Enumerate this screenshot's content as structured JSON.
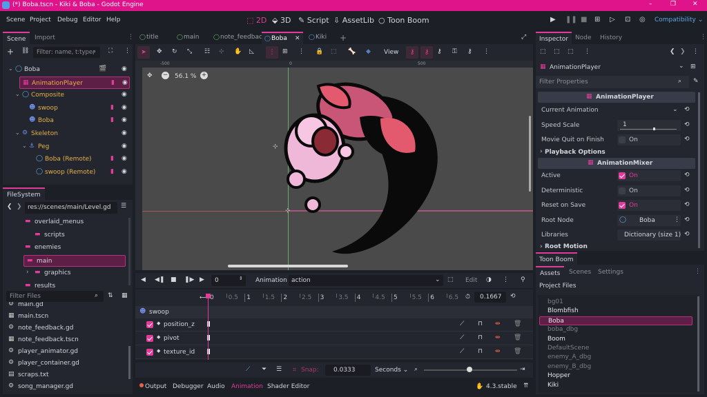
{
  "titlebar": {
    "title": "(*) Boba.tscn - Kiki & Boba - Godot Engine",
    "minimize": "–",
    "maximize": "❐",
    "close": "✕"
  },
  "menu": [
    "Scene",
    "Project",
    "Debug",
    "Editor",
    "Help"
  ],
  "main_tabs": [
    "2D",
    "3D",
    "Script",
    "AssetLib",
    "Toon Boom"
  ],
  "renderer": "Compatibility",
  "scene_dock": {
    "tabs": [
      "Scene",
      "Import"
    ],
    "filter_placeholder": "Filter: name, t:type,",
    "tree": [
      {
        "label": "Boba",
        "indent": 0,
        "color": "#d4d6dc"
      },
      {
        "label": "AnimationPlayer",
        "indent": 1,
        "color": "#e7b24a",
        "selected": true
      },
      {
        "label": "Composite",
        "indent": 1,
        "color": "#e7b24a"
      },
      {
        "label": "swoop",
        "indent": 2,
        "color": "#e7b24a"
      },
      {
        "label": "Boba",
        "indent": 2,
        "color": "#e7b24a"
      },
      {
        "label": "Skeleton",
        "indent": 1,
        "color": "#e7b24a"
      },
      {
        "label": "Peg",
        "indent": 2,
        "color": "#e7b24a"
      },
      {
        "label": "Boba (Remote)",
        "indent": 3,
        "color": "#e7b24a"
      },
      {
        "label": "swoop (Remote)",
        "indent": 3,
        "color": "#e7b24a"
      }
    ]
  },
  "filesystem": {
    "tab": "FileSystem",
    "path": "res://scenes/main/Level.gd",
    "folders": [
      "overlaid_menus",
      "scripts",
      "enemies",
      "main",
      "graphics",
      "results"
    ],
    "filter_placeholder": "Filter Files",
    "files": [
      "main.gd",
      "main.tscn",
      "note_feedback.gd",
      "note_feedback.tscn",
      "player_animator.gd",
      "player_container.gd",
      "scraps.txt",
      "song_manager.gd"
    ]
  },
  "editor_tabs": [
    "title",
    "main",
    "note_feedback",
    "Boba",
    "Kiki"
  ],
  "toolbar": {
    "view": "View"
  },
  "viewport": {
    "zoom": "56.1 %",
    "ruler": [
      "-500",
      "0",
      "500"
    ],
    "vruler": [
      "-500",
      "0"
    ]
  },
  "animation": {
    "frame": "0",
    "label": "Animation",
    "name": "action",
    "edit": "Edit",
    "ticks": [
      "0",
      "0.5",
      "1",
      "1.5",
      "2",
      "2.5",
      "3",
      "3.5",
      "4",
      "4.5",
      "5",
      "5.5",
      "6",
      "6.5"
    ],
    "length": "0.1667",
    "track_group": "swoop",
    "tracks": [
      "position_z",
      "pivot",
      "texture_id"
    ],
    "snap_label": "Snap:",
    "snap_value": "0.0333",
    "unit": "Seconds"
  },
  "bottom_tabs": [
    "Output",
    "Debugger",
    "Audio",
    "Animation",
    "Shader Editor"
  ],
  "version": "4.3.stable",
  "inspector": {
    "tabs": [
      "Inspector",
      "Node",
      "History"
    ],
    "object": "AnimationPlayer",
    "filter_placeholder": "Filter Properties",
    "section1": "AnimationPlayer",
    "props1": [
      {
        "name": "Current Animation",
        "value": ""
      },
      {
        "name": "Speed Scale",
        "value": "1"
      },
      {
        "name": "Movie Quit on Finish",
        "value": "On",
        "checked": false
      }
    ],
    "group": "Playback Options",
    "section2": "AnimationMixer",
    "props2": [
      {
        "name": "Active",
        "value": "On",
        "checked": true
      },
      {
        "name": "Deterministic",
        "value": "On",
        "checked": false
      },
      {
        "name": "Reset on Save",
        "value": "On",
        "checked": true
      },
      {
        "name": "Root Node",
        "value": "Boba"
      },
      {
        "name": "Libraries",
        "value": "Dictionary (size 1)"
      }
    ],
    "group2": "Root Motion"
  },
  "toonboom": {
    "title": "Toon Boom",
    "tabs": [
      "Assets",
      "Scenes",
      "Settings"
    ],
    "list_title": "Project Files",
    "items": [
      {
        "label": "bg01",
        "dim": true
      },
      {
        "label": "Blombfish",
        "dim": false
      },
      {
        "label": "Boba",
        "dim": false,
        "selected": true
      },
      {
        "label": "boba_dbg",
        "dim": true
      },
      {
        "label": "Boom",
        "dim": false
      },
      {
        "label": "DefaultScene",
        "dim": true
      },
      {
        "label": "enemy_A_dbg",
        "dim": true
      },
      {
        "label": "enemy_B_dbg",
        "dim": true
      },
      {
        "label": "Hopper",
        "dim": false
      },
      {
        "label": "Kiki",
        "dim": false
      }
    ]
  },
  "colors": {
    "accent": "#e23c9b",
    "titlebar": "#e0148a",
    "selected_bg": "#5e1f47",
    "node_yellow": "#e7b24a"
  }
}
